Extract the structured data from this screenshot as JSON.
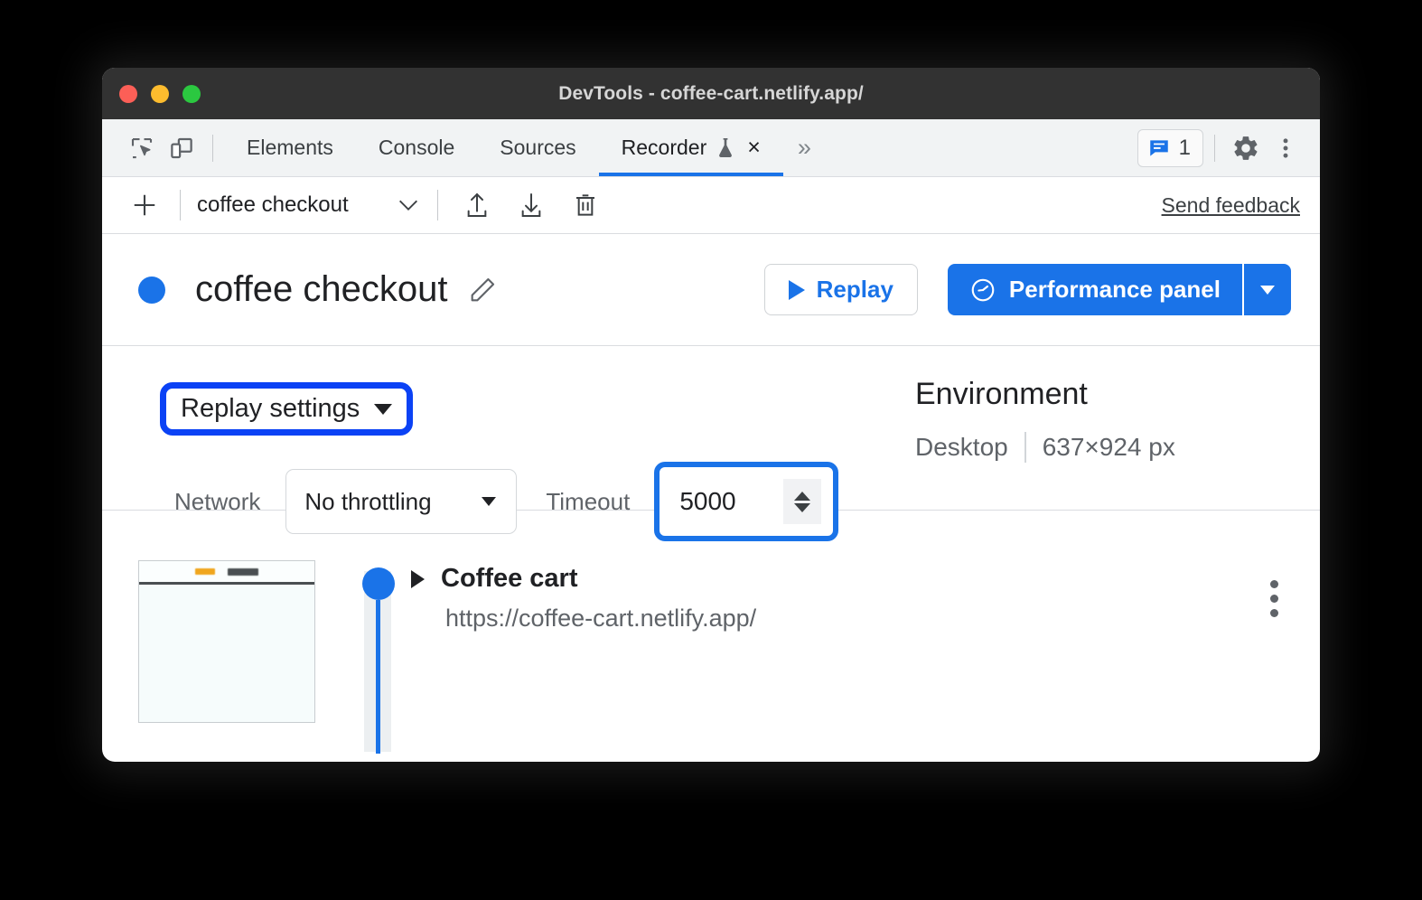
{
  "window": {
    "title": "DevTools - coffee-cart.netlify.app/",
    "traffic_lights": [
      "close",
      "minimize",
      "zoom"
    ]
  },
  "tabstrip": {
    "left_icons": [
      {
        "name": "inspect-element-icon",
        "label": "Inspect element"
      },
      {
        "name": "device-toolbar-icon",
        "label": "Toggle device toolbar"
      }
    ],
    "tabs": [
      {
        "label": "Elements",
        "active": false
      },
      {
        "label": "Console",
        "active": false
      },
      {
        "label": "Sources",
        "active": false
      },
      {
        "label": "Recorder",
        "active": true,
        "experimental": true,
        "closable": true
      }
    ],
    "close_label": "×",
    "more_tabs_label": "»",
    "issues_count": "1",
    "right_icons": [
      {
        "name": "issues-icon"
      },
      {
        "name": "settings-gear-icon"
      },
      {
        "name": "more-options-icon"
      }
    ]
  },
  "recorder_toolbar": {
    "add_label": "+",
    "recording_name": "coffee checkout",
    "dropdown_chevron": "∨",
    "actions": [
      {
        "name": "export-recording-icon"
      },
      {
        "name": "import-recording-icon"
      },
      {
        "name": "delete-recording-icon"
      }
    ],
    "send_feedback_label": "Send feedback"
  },
  "recording_header": {
    "status": "idle",
    "status_color": "#1a73e8",
    "title": "coffee checkout",
    "edit_title_label": "Edit title",
    "replay_label": "Replay",
    "performance_panel_label": "Performance panel",
    "performance_split_label": "▼"
  },
  "replay_settings": {
    "section_label": "Replay settings",
    "expanded": true,
    "highlight_color": "#0b42f5",
    "network_label": "Network",
    "network_value": "No throttling",
    "timeout_label": "Timeout",
    "timeout_value": "5000",
    "timeout_highlight_color": "#1a73e8"
  },
  "environment": {
    "title": "Environment",
    "device": "Desktop",
    "viewport": "637×924 px"
  },
  "steps": [
    {
      "title": "Coffee cart",
      "url": "https://coffee-cart.netlify.app/",
      "expand_label": "▶",
      "menu_label": "More options",
      "has_screenshot": true
    }
  ]
}
